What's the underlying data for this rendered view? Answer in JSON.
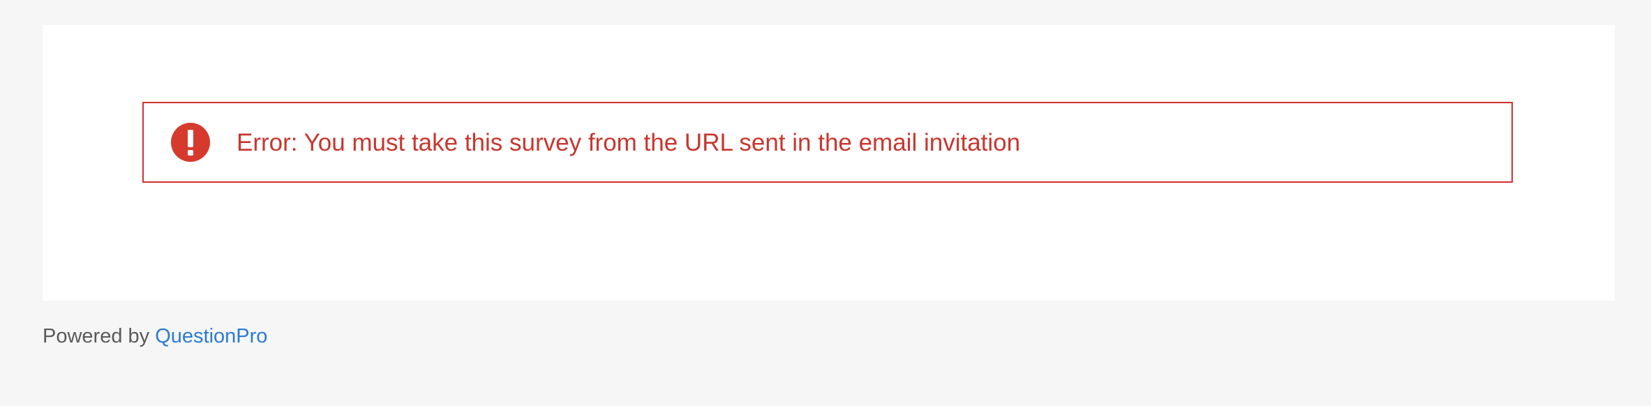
{
  "error": {
    "icon": "exclamation-circle-icon",
    "message": "Error: You must take this survey from the URL sent in the email invitation",
    "color": "#d0312d"
  },
  "footer": {
    "prefix": "Powered by",
    "brand": "QuestionPro",
    "brand_color": "#2b7bd2"
  }
}
